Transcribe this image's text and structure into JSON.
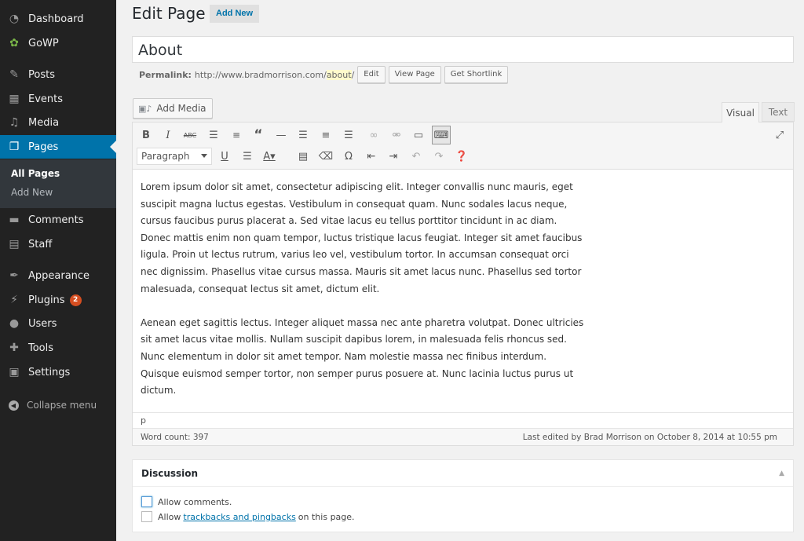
{
  "sidebar": {
    "items": [
      {
        "label": "Dashboard",
        "icon": "dashboard-icon",
        "glyph": "◔"
      },
      {
        "label": "GoWP",
        "icon": "gowp-icon",
        "glyph": "✿"
      },
      {
        "label": "Posts",
        "icon": "pin-icon",
        "glyph": "✎"
      },
      {
        "label": "Events",
        "icon": "calendar-icon",
        "glyph": "▦"
      },
      {
        "label": "Media",
        "icon": "media-icon",
        "glyph": "♫"
      },
      {
        "label": "Pages",
        "icon": "pages-icon",
        "glyph": "❐"
      },
      {
        "label": "Comments",
        "icon": "comment-icon",
        "glyph": "▬"
      },
      {
        "label": "Staff",
        "icon": "staff-icon",
        "glyph": "▤"
      },
      {
        "label": "Appearance",
        "icon": "appearance-icon",
        "glyph": "✒"
      },
      {
        "label": "Plugins",
        "icon": "plugins-icon",
        "glyph": "⚡",
        "badge": "2"
      },
      {
        "label": "Users",
        "icon": "users-icon",
        "glyph": "●"
      },
      {
        "label": "Tools",
        "icon": "tools-icon",
        "glyph": "✚"
      },
      {
        "label": "Settings",
        "icon": "settings-icon",
        "glyph": "▣"
      }
    ],
    "submenu": {
      "all_pages": "All Pages",
      "add_new": "Add New"
    },
    "collapse_label": "Collapse menu"
  },
  "header": {
    "title": "Edit Page",
    "add_new": "Add New"
  },
  "title_field": {
    "value": "About"
  },
  "permalink": {
    "label": "Permalink:",
    "url_prefix": "http://www.bradmorrison.com/",
    "slug": "about",
    "url_suffix": "/",
    "edit": "Edit",
    "view": "View Page",
    "shortlink": "Get Shortlink"
  },
  "media": {
    "add_media": "Add Media"
  },
  "tabs": {
    "visual": "Visual",
    "text": "Text"
  },
  "toolbar": {
    "format": "Paragraph"
  },
  "content": {
    "paragraphs": [
      "Lorem ipsum dolor sit amet, consectetur adipiscing elit. Integer convallis nunc mauris, eget suscipit magna luctus egestas. Vestibulum in consequat quam. Nunc sodales lacus neque, cursus faucibus purus placerat a. Sed vitae lacus eu tellus porttitor tincidunt in ac diam. Donec mattis enim non quam tempor, luctus tristique lacus feugiat. Integer sit amet faucibus ligula. Proin ut lectus rutrum, varius leo vel, vestibulum tortor. In accumsan consequat orci nec dignissim. Phasellus vitae cursus massa. Mauris sit amet lacus nunc. Phasellus sed tortor malesuada, consequat lectus sit amet, dictum elit.",
      "Aenean eget sagittis lectus. Integer aliquet massa nec ante pharetra volutpat. Donec ultricies sit amet lacus vitae mollis. Nullam suscipit dapibus lorem, in malesuada felis rhoncus sed. Nunc elementum in dolor sit amet tempor. Nam molestie massa nec finibus interdum. Quisque euismod semper tortor, non semper purus posuere at. Nunc lacinia luctus purus ut dictum."
    ]
  },
  "editor_footer": {
    "path": "p",
    "word_count": "Word count: 397",
    "last_edited": "Last edited by Brad Morrison on October 8, 2014 at 10:55 pm"
  },
  "discussion": {
    "title": "Discussion",
    "allow_comments": "Allow comments.",
    "allow_prefix": "Allow",
    "trackbacks_link": "trackbacks and pingbacks",
    "allow_suffix": "on this page."
  },
  "colors": {
    "sidebar_bg": "#222222",
    "active": "#0073aa",
    "badge": "#d54e21",
    "link": "#0073aa"
  }
}
